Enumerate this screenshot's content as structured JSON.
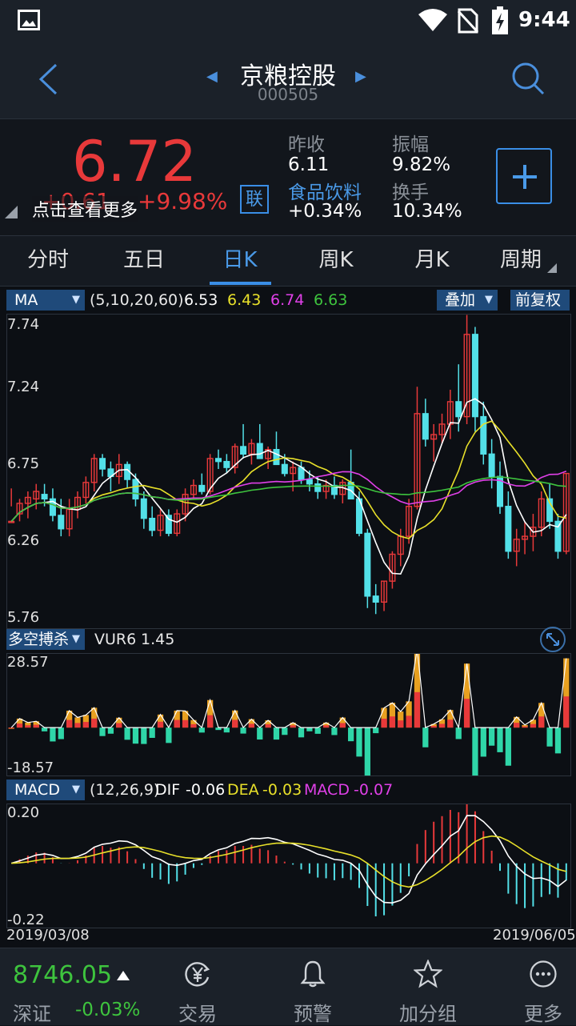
{
  "status": {
    "time": "9:44"
  },
  "header": {
    "title": "京粮控股",
    "code": "000505"
  },
  "quote": {
    "price": "6.72",
    "change": "+0.61",
    "change_pct": "+9.98%",
    "hint": "点击查看更多",
    "lian": "联",
    "prev_close_label": "昨收",
    "prev_close": "6.11",
    "sector": "食品饮料",
    "sector_change": "+0.34%",
    "amplitude_label": "振幅",
    "amplitude": "9.82%",
    "turnover_label": "换手",
    "turnover": "10.34%"
  },
  "tabs": [
    "分时",
    "五日",
    "日K",
    "周K",
    "月K",
    "周期"
  ],
  "ma_bar": {
    "selector": "MA",
    "params": "(5,10,20,60)",
    "ma5": "6.53",
    "ma10": "6.43",
    "ma20": "6.74",
    "ma60": "6.63",
    "overlay": "叠加",
    "adjust": "前复权"
  },
  "main_axis": [
    "7.74",
    "7.24",
    "6.75",
    "6.26",
    "5.76"
  ],
  "vur_bar": {
    "selector": "多空搏杀",
    "label": "VUR6",
    "value": "1.45"
  },
  "vur_axis": [
    "28.57",
    "-18.57"
  ],
  "macd_bar": {
    "selector": "MACD",
    "params": "(12,26,9)",
    "dif_label": "DIF",
    "dif": "-0.06",
    "dea_label": "DEA",
    "dea": "-0.03",
    "macd_label": "MACD",
    "macd": "-0.07"
  },
  "macd_axis": [
    "0.20",
    "-0.22"
  ],
  "dates": {
    "start": "2019/03/08",
    "end": "2019/06/05"
  },
  "colors": {
    "up": "#e8393a",
    "down": "#53e0e8",
    "ma5": "#ffffff",
    "ma10": "#e8e02a",
    "ma20": "#e040e8",
    "ma60": "#3ec43e",
    "accent": "#3a8ee6"
  },
  "bottom": {
    "index_value": "8746.05",
    "index_name": "深证",
    "index_change": "-0.03%",
    "nav": [
      "交易",
      "预警",
      "加分组",
      "更多"
    ]
  },
  "chart_data": {
    "type": "candlestick",
    "y_range": [
      5.76,
      7.74
    ],
    "candles": [
      [
        6.4,
        6.62,
        6.5,
        6.4
      ],
      [
        6.45,
        6.55,
        6.4,
        6.52
      ],
      [
        6.52,
        6.6,
        6.42,
        6.56
      ],
      [
        6.55,
        6.65,
        6.48,
        6.6
      ],
      [
        6.58,
        6.65,
        6.5,
        6.55
      ],
      [
        6.55,
        6.62,
        6.4,
        6.44
      ],
      [
        6.44,
        6.55,
        6.3,
        6.35
      ],
      [
        6.35,
        6.55,
        6.3,
        6.48
      ],
      [
        6.48,
        6.6,
        6.42,
        6.56
      ],
      [
        6.56,
        6.7,
        6.52,
        6.66
      ],
      [
        6.66,
        6.85,
        6.6,
        6.82
      ],
      [
        6.82,
        6.85,
        6.7,
        6.75
      ],
      [
        6.75,
        6.8,
        6.6,
        6.7
      ],
      [
        6.7,
        6.85,
        6.65,
        6.78
      ],
      [
        6.78,
        6.8,
        6.62,
        6.68
      ],
      [
        6.68,
        6.72,
        6.5,
        6.55
      ],
      [
        6.55,
        6.6,
        6.35,
        6.42
      ],
      [
        6.42,
        6.5,
        6.3,
        6.34
      ],
      [
        6.34,
        6.48,
        6.3,
        6.44
      ],
      [
        6.44,
        6.48,
        6.3,
        6.32
      ],
      [
        6.32,
        6.48,
        6.3,
        6.45
      ],
      [
        6.45,
        6.62,
        6.4,
        6.58
      ],
      [
        6.58,
        6.68,
        6.55,
        6.64
      ],
      [
        6.64,
        6.72,
        6.58,
        6.6
      ],
      [
        6.6,
        6.85,
        6.58,
        6.82
      ],
      [
        6.82,
        6.88,
        6.75,
        6.8
      ],
      [
        6.8,
        6.85,
        6.72,
        6.76
      ],
      [
        6.76,
        6.92,
        6.72,
        6.9
      ],
      [
        6.9,
        7.05,
        6.82,
        6.85
      ],
      [
        6.85,
        6.95,
        6.78,
        6.92
      ],
      [
        6.92,
        7.05,
        6.85,
        6.82
      ],
      [
        6.82,
        6.9,
        6.75,
        6.88
      ],
      [
        6.88,
        7.0,
        6.82,
        6.78
      ],
      [
        6.78,
        6.85,
        6.7,
        6.72
      ],
      [
        6.72,
        6.8,
        6.6,
        6.76
      ],
      [
        6.76,
        6.8,
        6.65,
        6.68
      ],
      [
        6.68,
        6.74,
        6.6,
        6.65
      ],
      [
        6.65,
        6.7,
        6.55,
        6.6
      ],
      [
        6.6,
        6.68,
        6.55,
        6.64
      ],
      [
        6.64,
        6.7,
        6.55,
        6.58
      ],
      [
        6.58,
        6.68,
        6.52,
        6.66
      ],
      [
        6.66,
        6.88,
        6.62,
        6.55
      ],
      [
        6.55,
        6.6,
        6.3,
        6.32
      ],
      [
        6.32,
        6.35,
        5.82,
        5.9
      ],
      [
        5.9,
        5.98,
        5.78,
        5.86
      ],
      [
        5.86,
        6.0,
        5.8,
        6.0
      ],
      [
        6.0,
        6.2,
        5.95,
        6.18
      ],
      [
        6.18,
        6.35,
        6.1,
        6.3
      ],
      [
        6.3,
        6.55,
        6.25,
        6.5
      ],
      [
        6.5,
        7.3,
        6.48,
        7.12
      ],
      [
        7.12,
        7.22,
        6.9,
        6.95
      ],
      [
        6.95,
        7.05,
        6.8,
        6.98
      ],
      [
        6.98,
        7.12,
        6.92,
        7.05
      ],
      [
        7.05,
        7.28,
        6.95,
        7.2
      ],
      [
        7.2,
        7.45,
        7.0,
        7.1
      ],
      [
        7.1,
        7.78,
        7.05,
        7.65
      ],
      [
        7.65,
        7.7,
        7.0,
        7.1
      ],
      [
        7.1,
        7.2,
        6.78,
        6.85
      ],
      [
        6.85,
        6.95,
        6.62,
        6.7
      ],
      [
        6.7,
        6.8,
        6.45,
        6.5
      ],
      [
        6.5,
        6.6,
        6.15,
        6.2
      ],
      [
        6.2,
        6.35,
        6.1,
        6.28
      ],
      [
        6.28,
        6.4,
        6.18,
        6.3
      ],
      [
        6.3,
        6.45,
        6.2,
        6.36
      ],
      [
        6.36,
        6.6,
        6.3,
        6.55
      ],
      [
        6.55,
        6.65,
        6.35,
        6.4
      ],
      [
        6.4,
        6.45,
        6.15,
        6.2
      ],
      [
        6.2,
        6.72,
        6.18,
        6.72
      ]
    ]
  }
}
